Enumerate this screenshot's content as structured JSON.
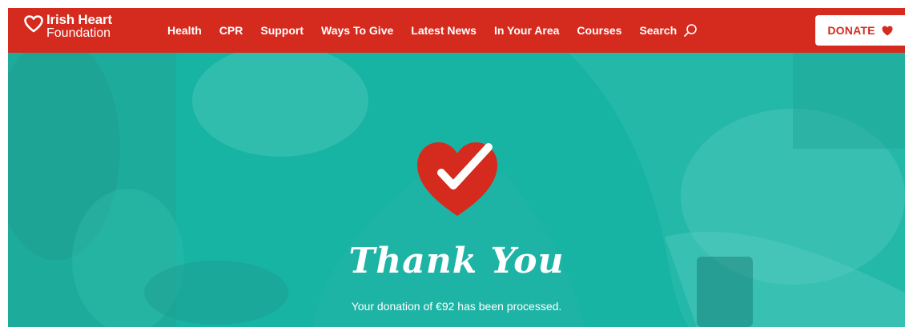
{
  "brand": {
    "name_line1": "Irish Heart",
    "name_line2": "Foundation",
    "red": "#d52b1e",
    "teal": "#17b3a3"
  },
  "nav": {
    "items": [
      {
        "label": "Health"
      },
      {
        "label": "CPR"
      },
      {
        "label": "Support"
      },
      {
        "label": "Ways To Give"
      },
      {
        "label": "Latest News"
      },
      {
        "label": "In Your Area"
      },
      {
        "label": "Courses"
      }
    ],
    "search_label": "Search",
    "search_icon": "search-icon"
  },
  "donate": {
    "label": "DONATE",
    "icon": "heart-icon"
  },
  "hero": {
    "icon": "heart-check-icon",
    "title": "Thank You",
    "message": "Your donation of €92 has been processed."
  }
}
